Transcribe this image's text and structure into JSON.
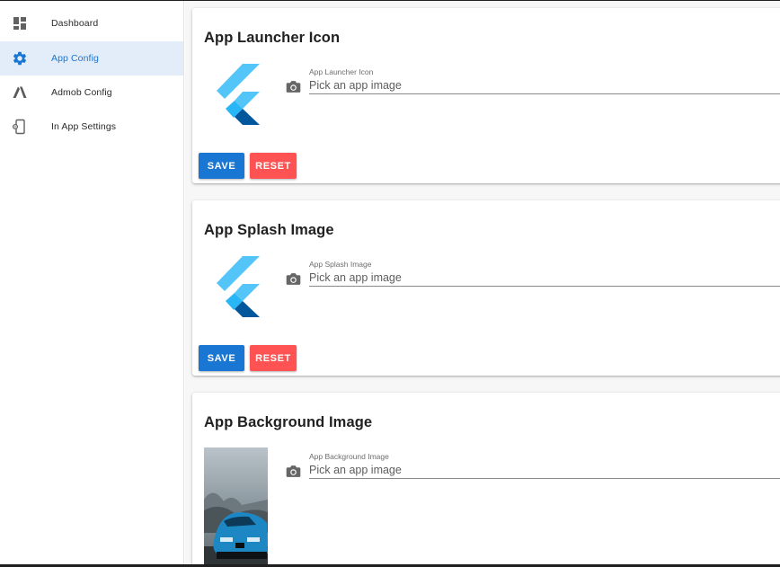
{
  "sidebar": {
    "items": [
      {
        "label": "Dashboard",
        "icon": "dashboard-icon"
      },
      {
        "label": "App Config",
        "icon": "gear-icon",
        "active": true
      },
      {
        "label": "Admob Config",
        "icon": "admob-icon"
      },
      {
        "label": "In App Settings",
        "icon": "phone-settings-icon"
      }
    ]
  },
  "cards": [
    {
      "title": "App Launcher Icon",
      "field_label": "App Launcher Icon",
      "placeholder": "Pick an app image",
      "save_label": "SAVE",
      "reset_label": "RESET",
      "image": "flutter-logo"
    },
    {
      "title": "App Splash Image",
      "field_label": "App Splash Image",
      "placeholder": "Pick an app image",
      "save_label": "SAVE",
      "reset_label": "RESET",
      "image": "flutter-logo"
    },
    {
      "title": "App Background Image",
      "field_label": "App Background Image",
      "placeholder": "Pick an app image",
      "image": "car-photo"
    }
  ],
  "colors": {
    "primary": "#1976d2",
    "accent_reset": "#ff5252",
    "active_nav_bg": "#e3edf9"
  }
}
